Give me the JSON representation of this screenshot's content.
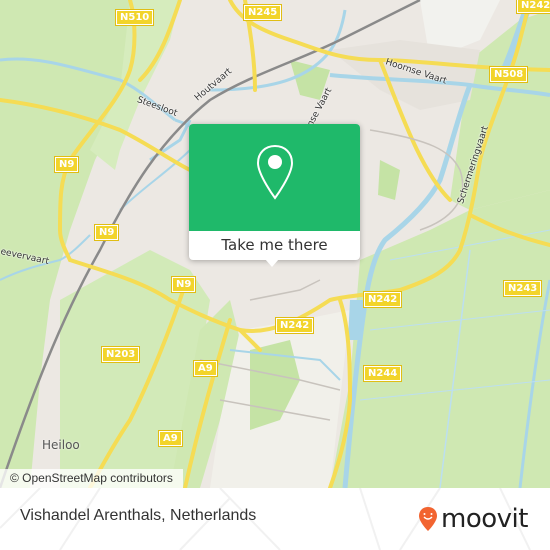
{
  "map": {
    "road_shields": [
      {
        "id": "n510",
        "label": "N510"
      },
      {
        "id": "n245",
        "label": "N245"
      },
      {
        "id": "n242-top",
        "label": "N242"
      },
      {
        "id": "n508",
        "label": "N508"
      },
      {
        "id": "n9-a",
        "label": "N9"
      },
      {
        "id": "n9-b",
        "label": "N9"
      },
      {
        "id": "n9-c",
        "label": "N9"
      },
      {
        "id": "n242-mid",
        "label": "N242"
      },
      {
        "id": "n242-left",
        "label": "N242"
      },
      {
        "id": "n243",
        "label": "N243"
      },
      {
        "id": "n203",
        "label": "N203"
      },
      {
        "id": "a9-a",
        "label": "A9"
      },
      {
        "id": "n244",
        "label": "N244"
      },
      {
        "id": "a9-b",
        "label": "A9"
      }
    ],
    "water_labels": {
      "steesloot": "Steesloot",
      "houtvaart": "Houtvaart",
      "hoornse_vaart_1": "Hoornse Vaart",
      "hoornse_vaart_2": "Hoornse Vaart",
      "schermeringvaart": "Schermeringvaart",
      "leevervaart": "eevervaart"
    },
    "town_labels": {
      "heiloo": "Heiloo"
    },
    "attribution": "© OpenStreetMap contributors"
  },
  "popup": {
    "icon": "map-pin-icon",
    "button_label": "Take me there",
    "color": "#1fb96a"
  },
  "footer": {
    "place_name": "Vishandel Arenthals, Netherlands",
    "brand": "moovit",
    "brand_color": "#f26430"
  }
}
